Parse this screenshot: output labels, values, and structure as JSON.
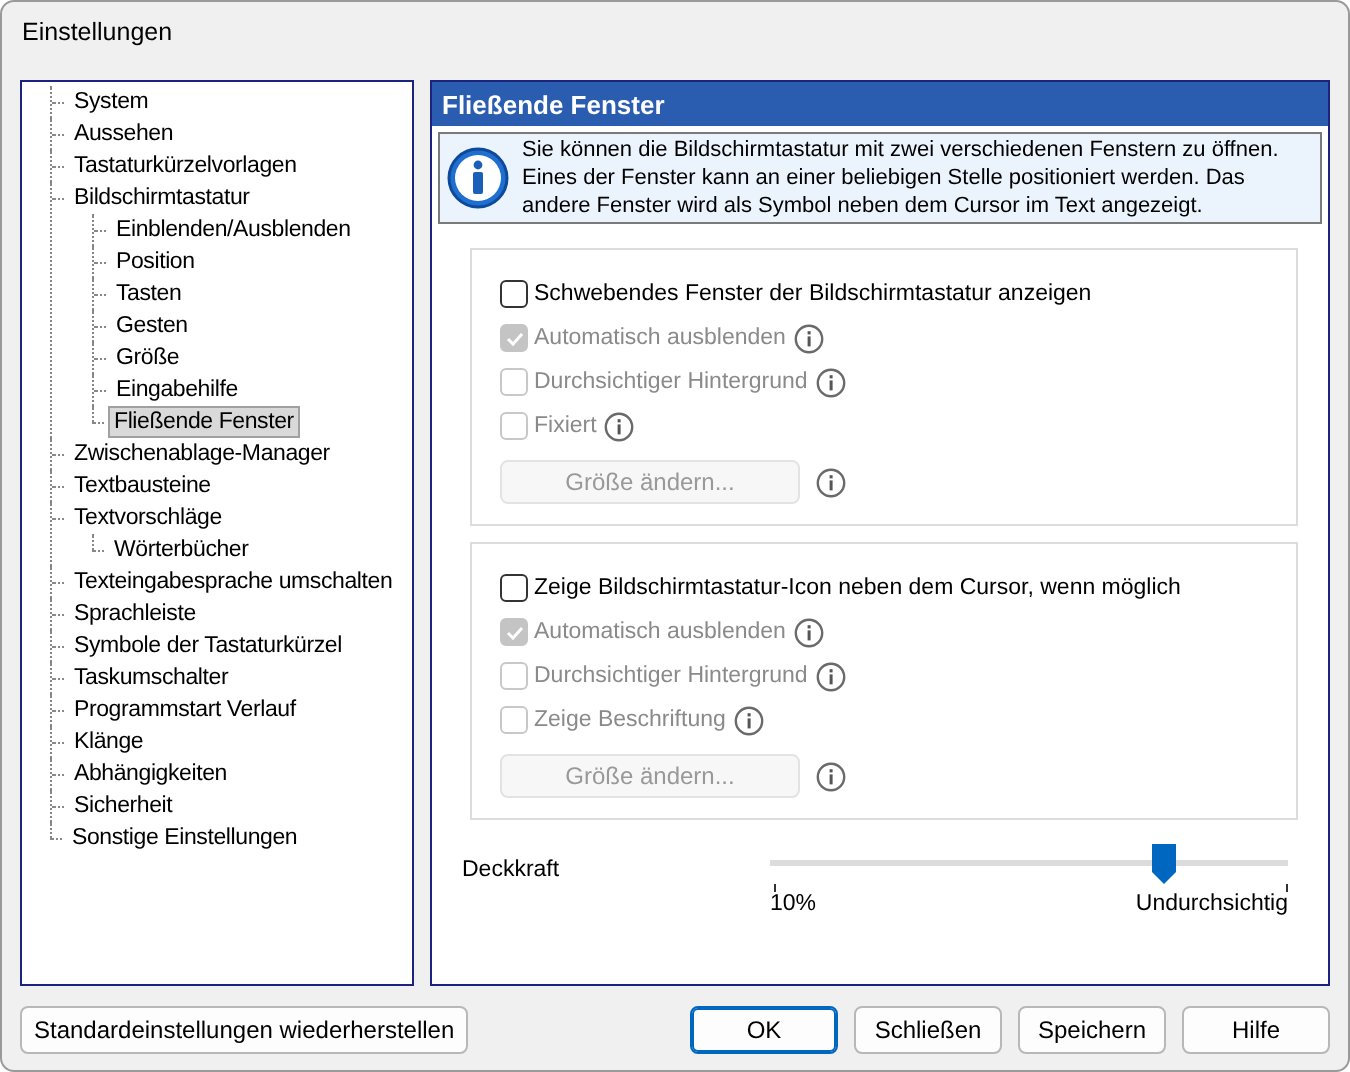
{
  "window": {
    "title": "Einstellungen"
  },
  "tree": [
    {
      "label": "System",
      "selected": false
    },
    {
      "label": "Aussehen",
      "selected": false
    },
    {
      "label": "Tastaturkürzelvorlagen",
      "selected": false
    },
    {
      "label": "Bildschirmtastatur",
      "selected": false,
      "children": [
        {
          "label": "Einblenden/Ausblenden",
          "selected": false
        },
        {
          "label": "Position",
          "selected": false
        },
        {
          "label": "Tasten",
          "selected": false
        },
        {
          "label": "Gesten",
          "selected": false
        },
        {
          "label": "Größe",
          "selected": false
        },
        {
          "label": "Eingabehilfe",
          "selected": false
        },
        {
          "label": "Fließende Fenster",
          "selected": true
        }
      ]
    },
    {
      "label": "Zwischenablage-Manager",
      "selected": false
    },
    {
      "label": "Textbausteine",
      "selected": false
    },
    {
      "label": "Textvorschläge",
      "selected": false,
      "children": [
        {
          "label": "Wörterbücher",
          "selected": false
        }
      ]
    },
    {
      "label": "Texteingabesprache umschalten",
      "selected": false
    },
    {
      "label": "Sprachleiste",
      "selected": false
    },
    {
      "label": "Symbole der Tastaturkürzel",
      "selected": false
    },
    {
      "label": "Taskumschalter",
      "selected": false
    },
    {
      "label": "Programmstart Verlauf",
      "selected": false
    },
    {
      "label": "Klänge",
      "selected": false
    },
    {
      "label": "Abhängigkeiten",
      "selected": false
    },
    {
      "label": "Sicherheit",
      "selected": false
    },
    {
      "label": "Sonstige Einstellungen",
      "selected": false
    }
  ],
  "panel": {
    "title": "Fließende Fenster",
    "info": "Sie können die Bildschirmtastatur mit zwei verschiedenen Fenstern zu öffnen. Eines der Fenster kann an einer beliebigen Stelle positioniert werden. Das andere Fenster wird als Symbol neben dem Cursor im Text angezeigt.",
    "groups": [
      {
        "rows": [
          {
            "kind": "checkbox",
            "label": "Schwebendes Fenster der Bildschirmtastatur anzeigen",
            "checked": false,
            "disabled": false,
            "info": false
          },
          {
            "kind": "checkbox",
            "label": "Automatisch ausblenden",
            "checked": true,
            "disabled": true,
            "info": true
          },
          {
            "kind": "checkbox",
            "label": "Durchsichtiger Hintergrund",
            "checked": false,
            "disabled": true,
            "info": true
          },
          {
            "kind": "checkbox",
            "label": "Fixiert",
            "checked": false,
            "disabled": true,
            "info": true
          },
          {
            "kind": "button",
            "label": "Größe ändern...",
            "disabled": true,
            "info": true
          }
        ]
      },
      {
        "rows": [
          {
            "kind": "checkbox",
            "label": "Zeige Bildschirmtastatur-Icon neben dem Cursor, wenn möglich",
            "checked": false,
            "disabled": false,
            "info": false
          },
          {
            "kind": "checkbox",
            "label": "Automatisch ausblenden",
            "checked": true,
            "disabled": true,
            "info": true
          },
          {
            "kind": "checkbox",
            "label": "Durchsichtiger Hintergrund",
            "checked": false,
            "disabled": true,
            "info": true
          },
          {
            "kind": "checkbox",
            "label": "Zeige Beschriftung",
            "checked": false,
            "disabled": true,
            "info": true
          },
          {
            "kind": "button",
            "label": "Größe ändern...",
            "disabled": true,
            "info": true
          }
        ]
      }
    ],
    "slider": {
      "label": "Deckkraft",
      "level": 0.76,
      "min_label": "10%",
      "max_label": "Undurchsichtig"
    }
  },
  "buttons": [
    {
      "label": "Standardeinstellungen wiederherstellen",
      "kind": "left"
    },
    {
      "label": "OK",
      "kind": "primary"
    },
    {
      "label": "Schließen",
      "kind": "normal"
    },
    {
      "label": "Speichern",
      "kind": "normal"
    },
    {
      "label": "Hilfe",
      "kind": "normal"
    }
  ]
}
